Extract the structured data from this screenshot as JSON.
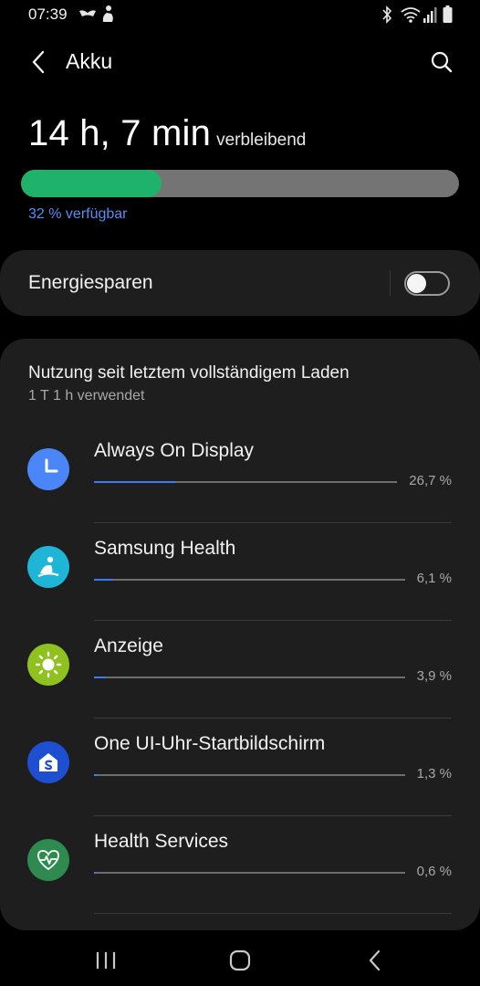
{
  "status_bar": {
    "time": "07:39",
    "left_icons": [
      "samsung-health-notif-icon",
      "person-notif-icon"
    ],
    "right_icons": [
      "bluetooth-icon",
      "wifi-icon",
      "signal-icon",
      "battery-icon"
    ]
  },
  "app_bar": {
    "title": "Akku",
    "back_icon": "back-arrow-icon",
    "search_icon": "search-icon"
  },
  "battery": {
    "remaining_time": "14 h, 7 min",
    "remaining_label": "verbleibend",
    "percent": 32,
    "available_text": "32 % verfügbar",
    "fill_color": "#1fb26b"
  },
  "power_saving": {
    "label": "Energiesparen",
    "enabled": false
  },
  "usage": {
    "title": "Nutzung seit letztem vollständigem Laden",
    "subtitle": "1 T 1 h verwendet",
    "apps": [
      {
        "name": "Always On Display",
        "percent_text": "26,7 %",
        "percent": 26.7,
        "icon": "clock-icon",
        "icon_color": "#4a86f7"
      },
      {
        "name": "Samsung Health",
        "percent_text": "6,1 %",
        "percent": 6.1,
        "icon": "samsung-health-icon",
        "icon_color": "#1fb5d6"
      },
      {
        "name": "Anzeige",
        "percent_text": "3,9 %",
        "percent": 3.9,
        "icon": "brightness-icon",
        "icon_color": "#8fc21f"
      },
      {
        "name": "One UI-Uhr-Startbildschirm",
        "percent_text": "1,3 %",
        "percent": 1.3,
        "icon": "one-ui-watch-home-icon",
        "icon_color": "#1f4fd1"
      },
      {
        "name": "Health Services",
        "percent_text": "0,6 %",
        "percent": 0.6,
        "icon": "health-services-icon",
        "icon_color": "#2e8a4e"
      }
    ]
  },
  "nav_bar": {
    "buttons": [
      "recent-apps-icon",
      "home-icon",
      "back-icon"
    ]
  }
}
